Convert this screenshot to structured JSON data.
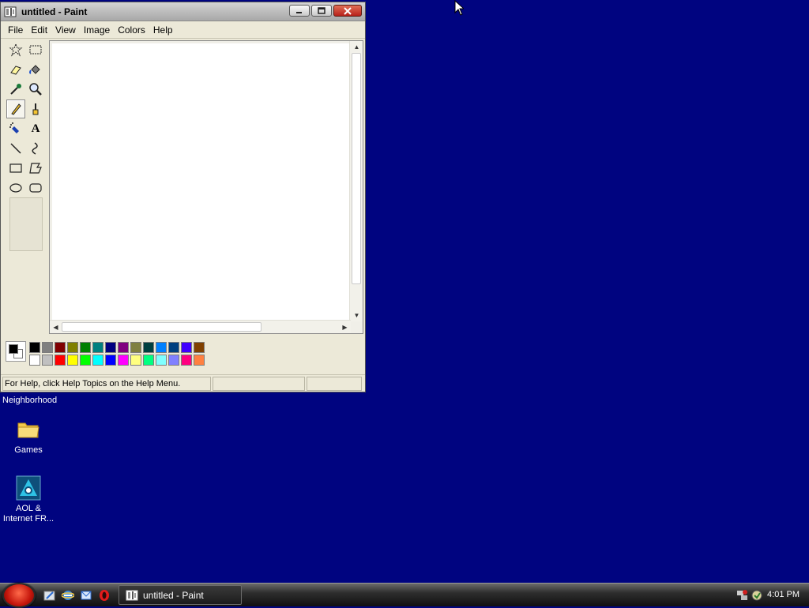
{
  "window": {
    "title": "untitled - Paint",
    "menu": [
      "File",
      "Edit",
      "View",
      "Image",
      "Colors",
      "Help"
    ],
    "status_text": "For Help, click Help Topics on the Help Menu."
  },
  "tools": [
    {
      "name": "free-form-select-tool",
      "icon": "star-select-icon"
    },
    {
      "name": "select-tool",
      "icon": "rect-select-icon"
    },
    {
      "name": "eraser-tool",
      "icon": "eraser-icon"
    },
    {
      "name": "fill-tool",
      "icon": "bucket-icon"
    },
    {
      "name": "pick-color-tool",
      "icon": "dropper-icon"
    },
    {
      "name": "magnifier-tool",
      "icon": "magnifier-icon"
    },
    {
      "name": "pencil-tool",
      "icon": "pencil-icon",
      "selected": true
    },
    {
      "name": "brush-tool",
      "icon": "brush-icon"
    },
    {
      "name": "airbrush-tool",
      "icon": "airbrush-icon"
    },
    {
      "name": "text-tool",
      "icon": "text-icon",
      "glyph": "A"
    },
    {
      "name": "line-tool",
      "icon": "line-icon"
    },
    {
      "name": "curve-tool",
      "icon": "curve-icon"
    },
    {
      "name": "rectangle-tool",
      "icon": "rectangle-icon"
    },
    {
      "name": "polygon-tool",
      "icon": "polygon-icon"
    },
    {
      "name": "ellipse-tool",
      "icon": "ellipse-icon"
    },
    {
      "name": "rounded-rectangle-tool",
      "icon": "rounded-rect-icon"
    }
  ],
  "palette": {
    "foreground": "#000000",
    "background": "#ffffff",
    "row1": [
      "#000000",
      "#808080",
      "#800000",
      "#808000",
      "#008000",
      "#008080",
      "#000080",
      "#800080",
      "#808040",
      "#004040",
      "#0080ff",
      "#004080",
      "#4000ff",
      "#804000"
    ],
    "row2": [
      "#ffffff",
      "#c0c0c0",
      "#ff0000",
      "#ffff00",
      "#00ff00",
      "#00ffff",
      "#0000ff",
      "#ff00ff",
      "#ffff80",
      "#00ff80",
      "#80ffff",
      "#8080ff",
      "#ff0080",
      "#ff8040"
    ]
  },
  "desktop": {
    "partial_label": "Neighborhood",
    "icons": [
      {
        "label": "Games",
        "icon": "folder-icon"
      },
      {
        "label": "AOL & Internet FR...",
        "icon": "aol-icon"
      }
    ]
  },
  "taskbar": {
    "task_label": "untitled - Paint",
    "clock": "4:01 PM",
    "quick_launch": [
      "show-desktop-icon",
      "internet-explorer-icon",
      "outlook-express-icon",
      "opera-icon"
    ]
  }
}
